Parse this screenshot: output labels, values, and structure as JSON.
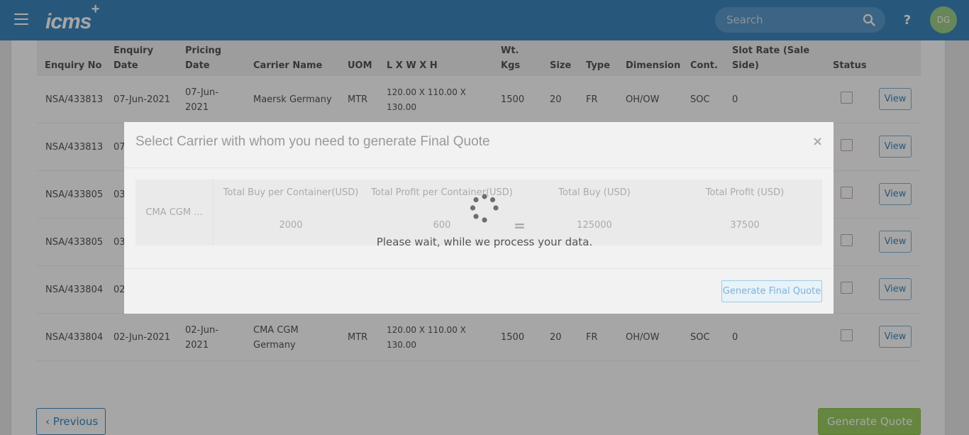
{
  "header": {
    "logo_text": "icms",
    "logo_plus": "+",
    "search_placeholder": "Search",
    "help_label": "?",
    "avatar_initials": "DG"
  },
  "table": {
    "headers": [
      "Enquiry No",
      "Enquiry Date",
      "Pricing Date",
      "Carrier Name",
      "UOM",
      "L X W X H",
      "Wt. Kgs",
      "Size",
      "Type",
      "Dimension",
      "Cont.",
      "Slot Rate (Sale Side)",
      "Status"
    ],
    "rows": [
      {
        "enquiry_no": "NSA/433813",
        "enquiry_date": "07-Jun-2021",
        "pricing_date": "07-Jun-2021",
        "carrier": "Maersk Germany",
        "uom": "MTR",
        "dims": "120.00 X 110.00 X 130.00",
        "wt": "1500",
        "size": "20",
        "type": "FR",
        "dimension": "OH/OW",
        "cont": "SOC",
        "slot_rate": "0",
        "view": "View"
      },
      {
        "enquiry_no": "NSA/433813",
        "enquiry_date": "07",
        "view": "View"
      },
      {
        "enquiry_no": "NSA/433805",
        "enquiry_date": "03",
        "view": "View"
      },
      {
        "enquiry_no": "NSA/433805",
        "enquiry_date": "03",
        "view": "View"
      },
      {
        "enquiry_no": "NSA/433804",
        "enquiry_date": "02",
        "view": "View"
      },
      {
        "enquiry_no": "NSA/433804",
        "enquiry_date": "02-Jun-2021",
        "pricing_date": "02-Jun-2021",
        "carrier": "CMA CGM Germany",
        "uom": "MTR",
        "dims": "120.00 X 110.00 X 130.00",
        "wt": "1500",
        "size": "20",
        "type": "FR",
        "dimension": "OH/OW",
        "cont": "SOC",
        "slot_rate": "0",
        "view": "View"
      }
    ]
  },
  "pagination": {
    "previous_label": "Previous",
    "generate_quote_label": "Generate Quote"
  },
  "modal": {
    "title": "Select Carrier with whom you need to generate Final Quote",
    "close_label": "×",
    "carrier_name": "CMA CGM ...",
    "columns": [
      {
        "header": "Total Buy per Container(USD)",
        "value": "2000"
      },
      {
        "header": "Total Profit per Container(USD)",
        "value": "600"
      },
      {
        "header": "Total Buy (USD)",
        "value": "125000"
      },
      {
        "header": "Total Profit (USD)",
        "value": "37500"
      }
    ],
    "equals_sign": "=",
    "generate_final_label": "Generate Final Quote"
  },
  "loading": {
    "message": "Please wait, while we process your data."
  },
  "colors": {
    "brand": "#3d87bf",
    "accent_green": "#9ccc65"
  }
}
